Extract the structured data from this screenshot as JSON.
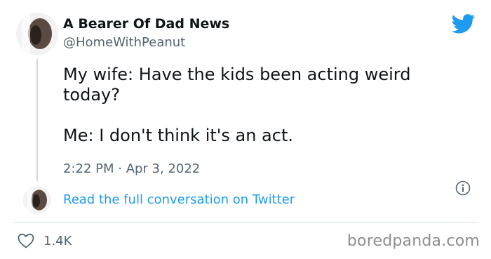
{
  "author": {
    "display_name": "A Bearer Of Dad News",
    "handle": "@HomeWithPeanut"
  },
  "tweet": {
    "line1": "My wife: Have the kids been acting weird today?",
    "line2": "Me: I don't think it's an act.",
    "timestamp": "2:22 PM · Apr 3, 2022"
  },
  "read_more_label": "Read the full conversation on Twitter",
  "likes": {
    "count": "1.4K"
  },
  "watermark": "boredpanda.com",
  "icons": {
    "brand": "twitter-bird-icon",
    "info": "info-icon",
    "like": "heart-icon"
  },
  "colors": {
    "twitter_blue": "#1d9bf0",
    "text_primary": "#0f1419",
    "text_secondary": "#536471",
    "divider": "#cfd9de"
  }
}
